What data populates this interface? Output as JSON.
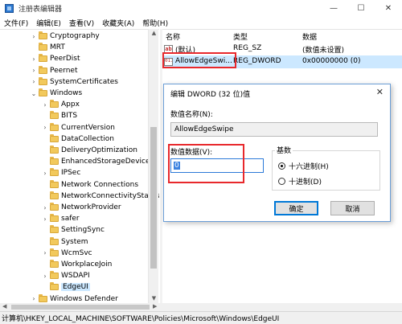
{
  "window": {
    "title": "注册表编辑器",
    "controls": {
      "minimize": "—",
      "maximize": "☐",
      "close": "✕"
    }
  },
  "menu": [
    "文件(F)",
    "编辑(E)",
    "查看(V)",
    "收藏夹(A)",
    "帮助(H)"
  ],
  "tree": {
    "items": [
      {
        "label": "Cryptography",
        "expand": "›"
      },
      {
        "label": "MRT",
        "expand": ""
      },
      {
        "label": "PeerDist",
        "expand": "›"
      },
      {
        "label": "Peernet",
        "expand": "›"
      },
      {
        "label": "SystemCertificates",
        "expand": "›"
      },
      {
        "label": "Windows",
        "expand": "⌄"
      },
      {
        "label": "Appx",
        "expand": "›"
      },
      {
        "label": "BITS",
        "expand": ""
      },
      {
        "label": "CurrentVersion",
        "expand": "›"
      },
      {
        "label": "DataCollection",
        "expand": ""
      },
      {
        "label": "DeliveryOptimization",
        "expand": ""
      },
      {
        "label": "EnhancedStorageDevices",
        "expand": ""
      },
      {
        "label": "IPSec",
        "expand": "›"
      },
      {
        "label": "Network Connections",
        "expand": ""
      },
      {
        "label": "NetworkConnectivityStatus",
        "expand": ""
      },
      {
        "label": "NetworkProvider",
        "expand": "›"
      },
      {
        "label": "safer",
        "expand": "›"
      },
      {
        "label": "SettingSync",
        "expand": ""
      },
      {
        "label": "System",
        "expand": ""
      },
      {
        "label": "WcmSvc",
        "expand": "›"
      },
      {
        "label": "WorkplaceJoin",
        "expand": ""
      },
      {
        "label": "WSDAPI",
        "expand": "›"
      },
      {
        "label": "EdgeUI",
        "expand": ""
      },
      {
        "label": "Windows Defender",
        "expand": "›"
      }
    ]
  },
  "list": {
    "headers": {
      "name": "名称",
      "type": "类型",
      "data": "数据"
    },
    "rows": [
      {
        "icon": "ab",
        "name": "(默认)",
        "type": "REG_SZ",
        "data": "(数值未设置)"
      },
      {
        "icon": "011",
        "name": "AllowEdgeSwi...",
        "type": "REG_DWORD",
        "data": "0x00000000 (0)"
      }
    ]
  },
  "dialog": {
    "title": "编辑 DWORD (32 位)值",
    "close": "✕",
    "name_label": "数值名称(N):",
    "name_value": "AllowEdgeSwipe",
    "data_label": "数值数据(V):",
    "data_value": "0",
    "base_label": "基数",
    "hex_label": "十六进制(H)",
    "dec_label": "十进制(D)",
    "ok": "确定",
    "cancel": "取消"
  },
  "status": "计算机\\HKEY_LOCAL_MACHINE\\SOFTWARE\\Policies\\Microsoft\\Windows\\EdgeUI",
  "colors": {
    "highlight_box": "#e8282c",
    "selection": "#cce8ff",
    "dialog_border": "#6a9dd6",
    "folder": "#f2c95c"
  }
}
